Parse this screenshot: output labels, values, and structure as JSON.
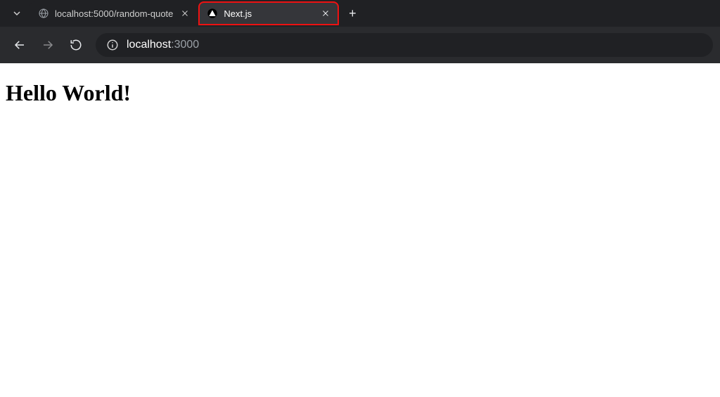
{
  "tabs": [
    {
      "title": "localhost:5000/random-quote",
      "favicon": "globe-icon",
      "active": false
    },
    {
      "title": "Next.js",
      "favicon": "nextjs-icon",
      "active": true
    }
  ],
  "newtab_label": "+",
  "nav": {
    "back": "←",
    "forward": "→",
    "reload": "⟳"
  },
  "address": {
    "host": "localhost",
    "port": ":3000"
  },
  "page": {
    "heading": "Hello World!"
  },
  "highlight_border_color": "#e11"
}
